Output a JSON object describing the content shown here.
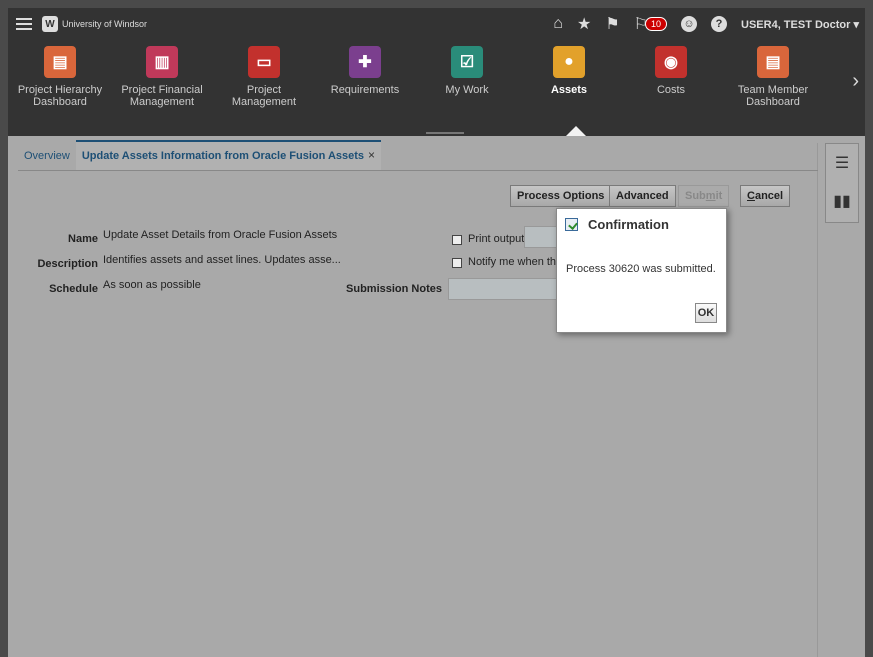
{
  "header": {
    "logo_text": "University of Windsor",
    "notification_count": "10",
    "user_label": "USER4, TEST Doctor ▾",
    "icons": [
      "menu-icon",
      "home-icon",
      "favorites-icon",
      "flag-icon",
      "notifications-icon",
      "accessibility-icon",
      "help-icon"
    ]
  },
  "springboard": {
    "items": [
      {
        "label": "Project Hierarchy Dashboard",
        "icon": "dashboard-icon",
        "color": "#d9663b"
      },
      {
        "label": "Project Financial Management",
        "icon": "chart-icon",
        "color": "#c0395a"
      },
      {
        "label": "Project Management",
        "icon": "project-icon",
        "color": "#c2312d"
      },
      {
        "label": "Requirements",
        "icon": "puzzle-icon",
        "color": "#7b3f8e"
      },
      {
        "label": "My Work",
        "icon": "checklist-icon",
        "color": "#2a8c7a"
      },
      {
        "label": "Assets",
        "icon": "assets-icon",
        "color": "#e2a12b"
      },
      {
        "label": "Costs",
        "icon": "costs-icon",
        "color": "#c2312d"
      },
      {
        "label": "Team Member Dashboard",
        "icon": "dashboard-icon",
        "color": "#d9663b"
      }
    ],
    "active": "Assets"
  },
  "tabs": [
    {
      "label": "Overview"
    },
    {
      "label": "Update Assets Information from Oracle Fusion Assets"
    }
  ],
  "buttons": {
    "process_options": "Process Options",
    "advanced": "Advanced",
    "submit_pre": "Sub",
    "submit_u": "m",
    "submit_post": "it",
    "cancel_u": "C",
    "cancel_post": "ancel"
  },
  "form": {
    "name_label": "Name",
    "name_value": "Update Asset Details from Oracle Fusion Assets",
    "description_label": "Description",
    "description_value": "Identifies assets and asset lines. Updates asse...",
    "schedule_label": "Schedule",
    "schedule_value": "As soon as possible",
    "print_output": "Print output",
    "notify_me": "Notify me when this",
    "submission_notes": "Submission Notes"
  },
  "dialog": {
    "title": "Confirmation",
    "message": "Process 30620 was submitted.",
    "ok": "OK"
  }
}
